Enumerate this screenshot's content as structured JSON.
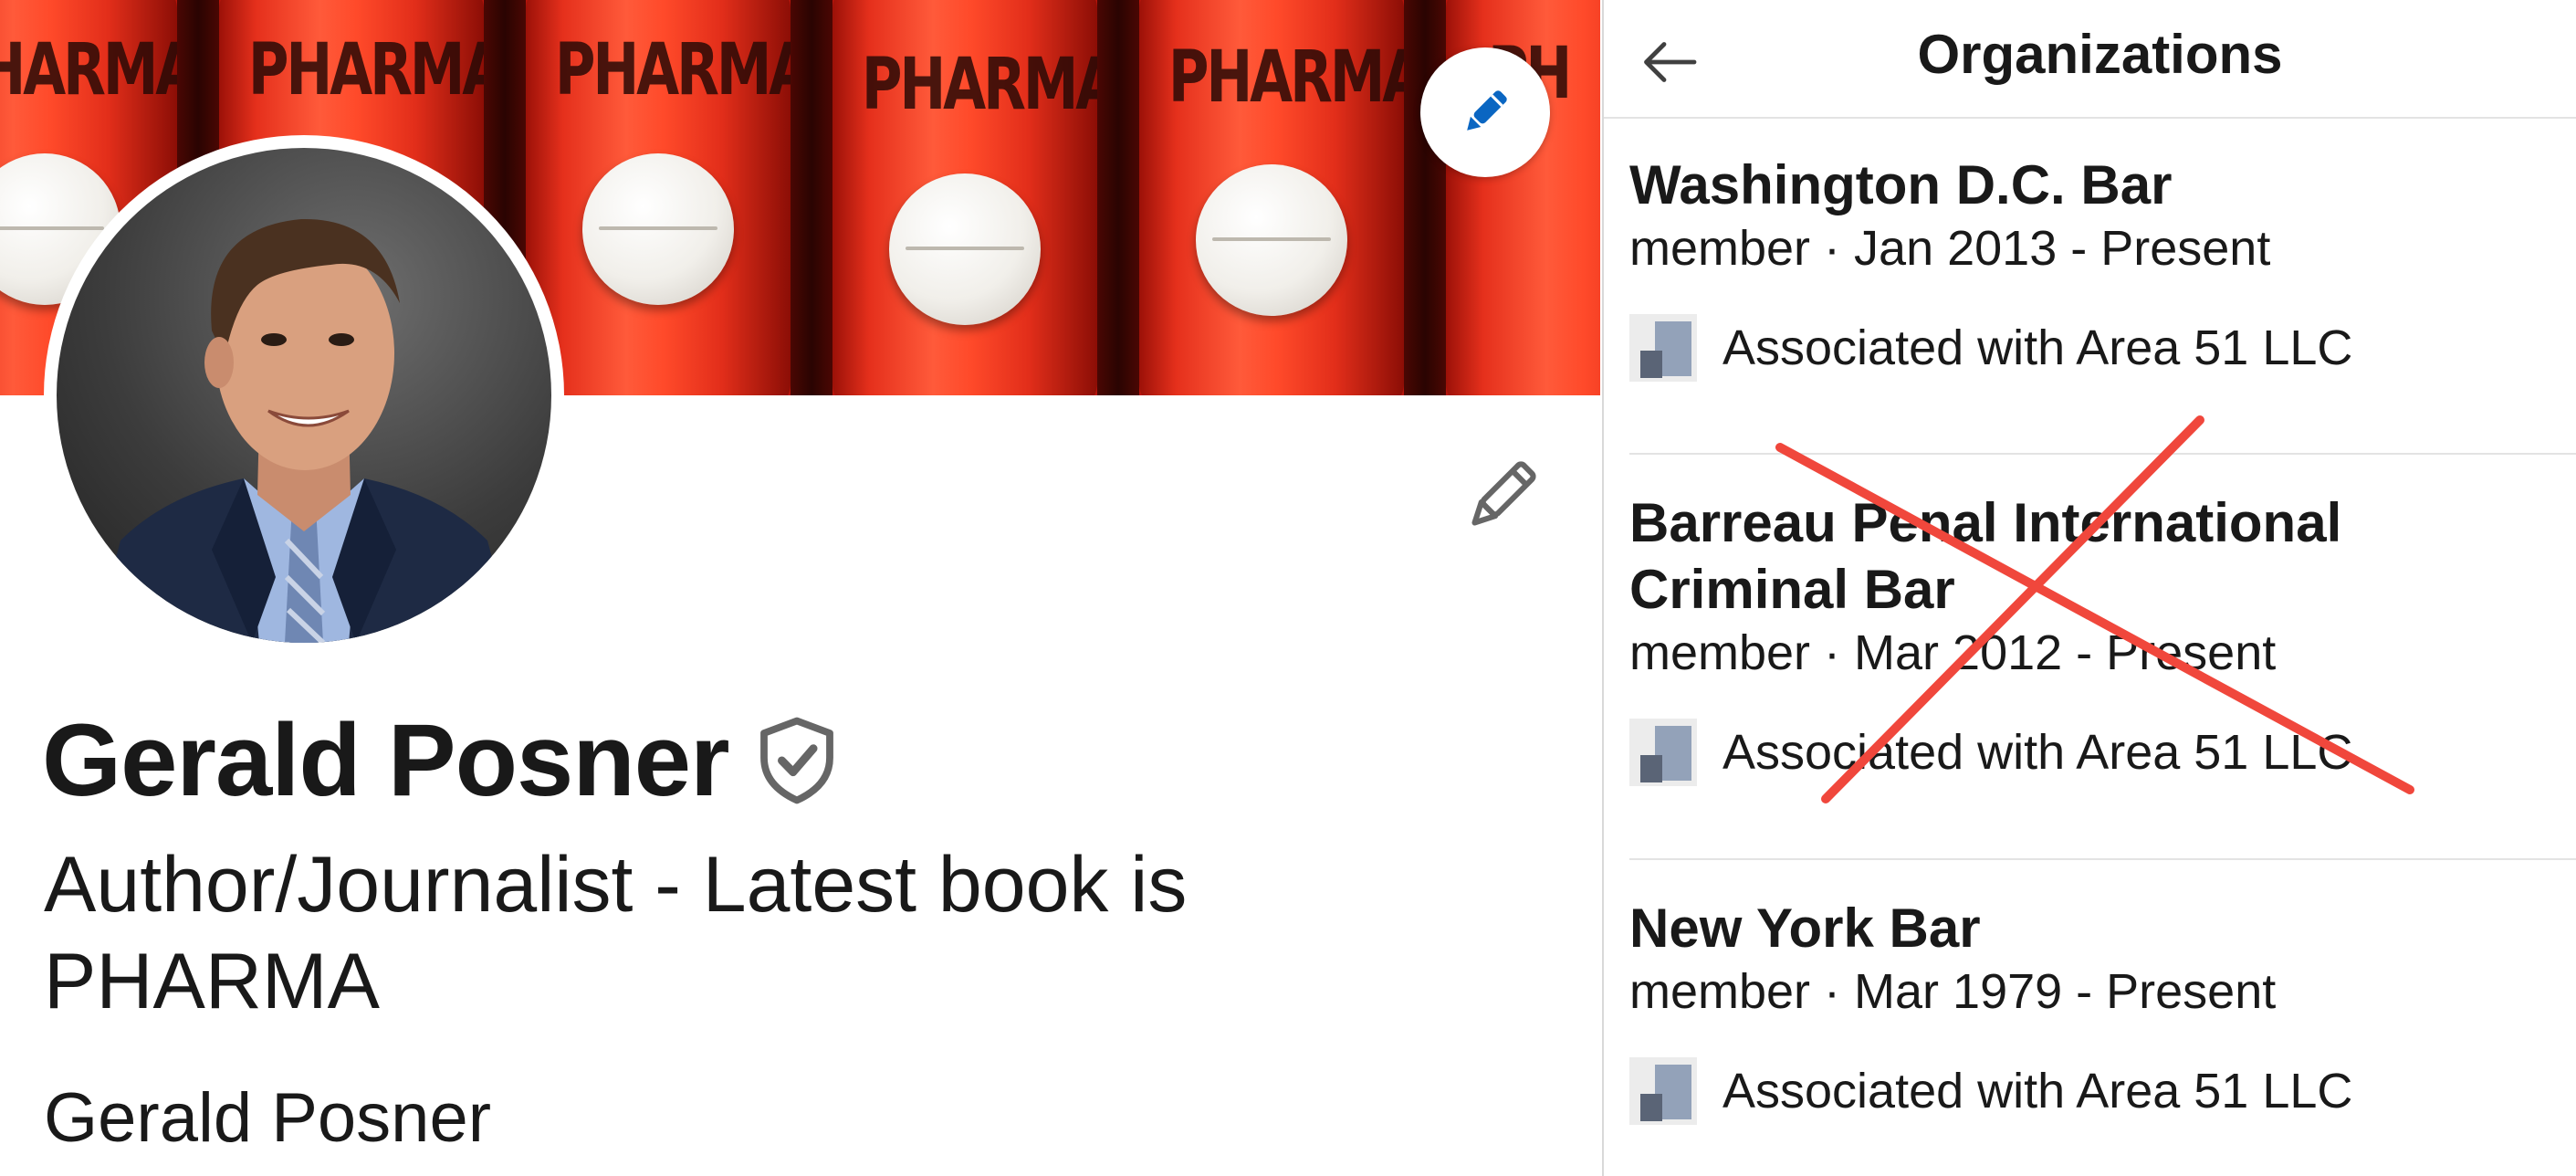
{
  "banner": {
    "bottles": [
      "PHARMA",
      "PHARMA",
      "PHARMA",
      "PHARMA",
      "PHARMA",
      "PH"
    ],
    "edit_icon": "pencil-icon"
  },
  "profile": {
    "name": "Gerald Posner",
    "verified_icon": "verified-shield-icon",
    "headline": "Author/Journalist - Latest book is PHARMA",
    "secondary_name": "Gerald Posner",
    "edit_icon": "pencil-outline-icon"
  },
  "organizations_panel": {
    "back_icon": "arrow-left-icon",
    "title": "Organizations",
    "items": [
      {
        "name": "Washington D.C. Bar",
        "meta": "member · Jan 2013 - Present",
        "association": "Associated with Area 51 LLC",
        "struck_out": false
      },
      {
        "name": "Barreau Penal International Criminal Bar",
        "meta": "member · Mar 2012 - Present",
        "association": "Associated with Area 51 LLC",
        "struck_out": true
      },
      {
        "name": "New York Bar",
        "meta": "member · Mar 1979 - Present",
        "association": "Associated with Area 51 LLC",
        "struck_out": false
      }
    ]
  },
  "colors": {
    "strike_red": "#f0473c",
    "edit_blue": "#0a66c2",
    "banner_red": "#e5301c"
  }
}
